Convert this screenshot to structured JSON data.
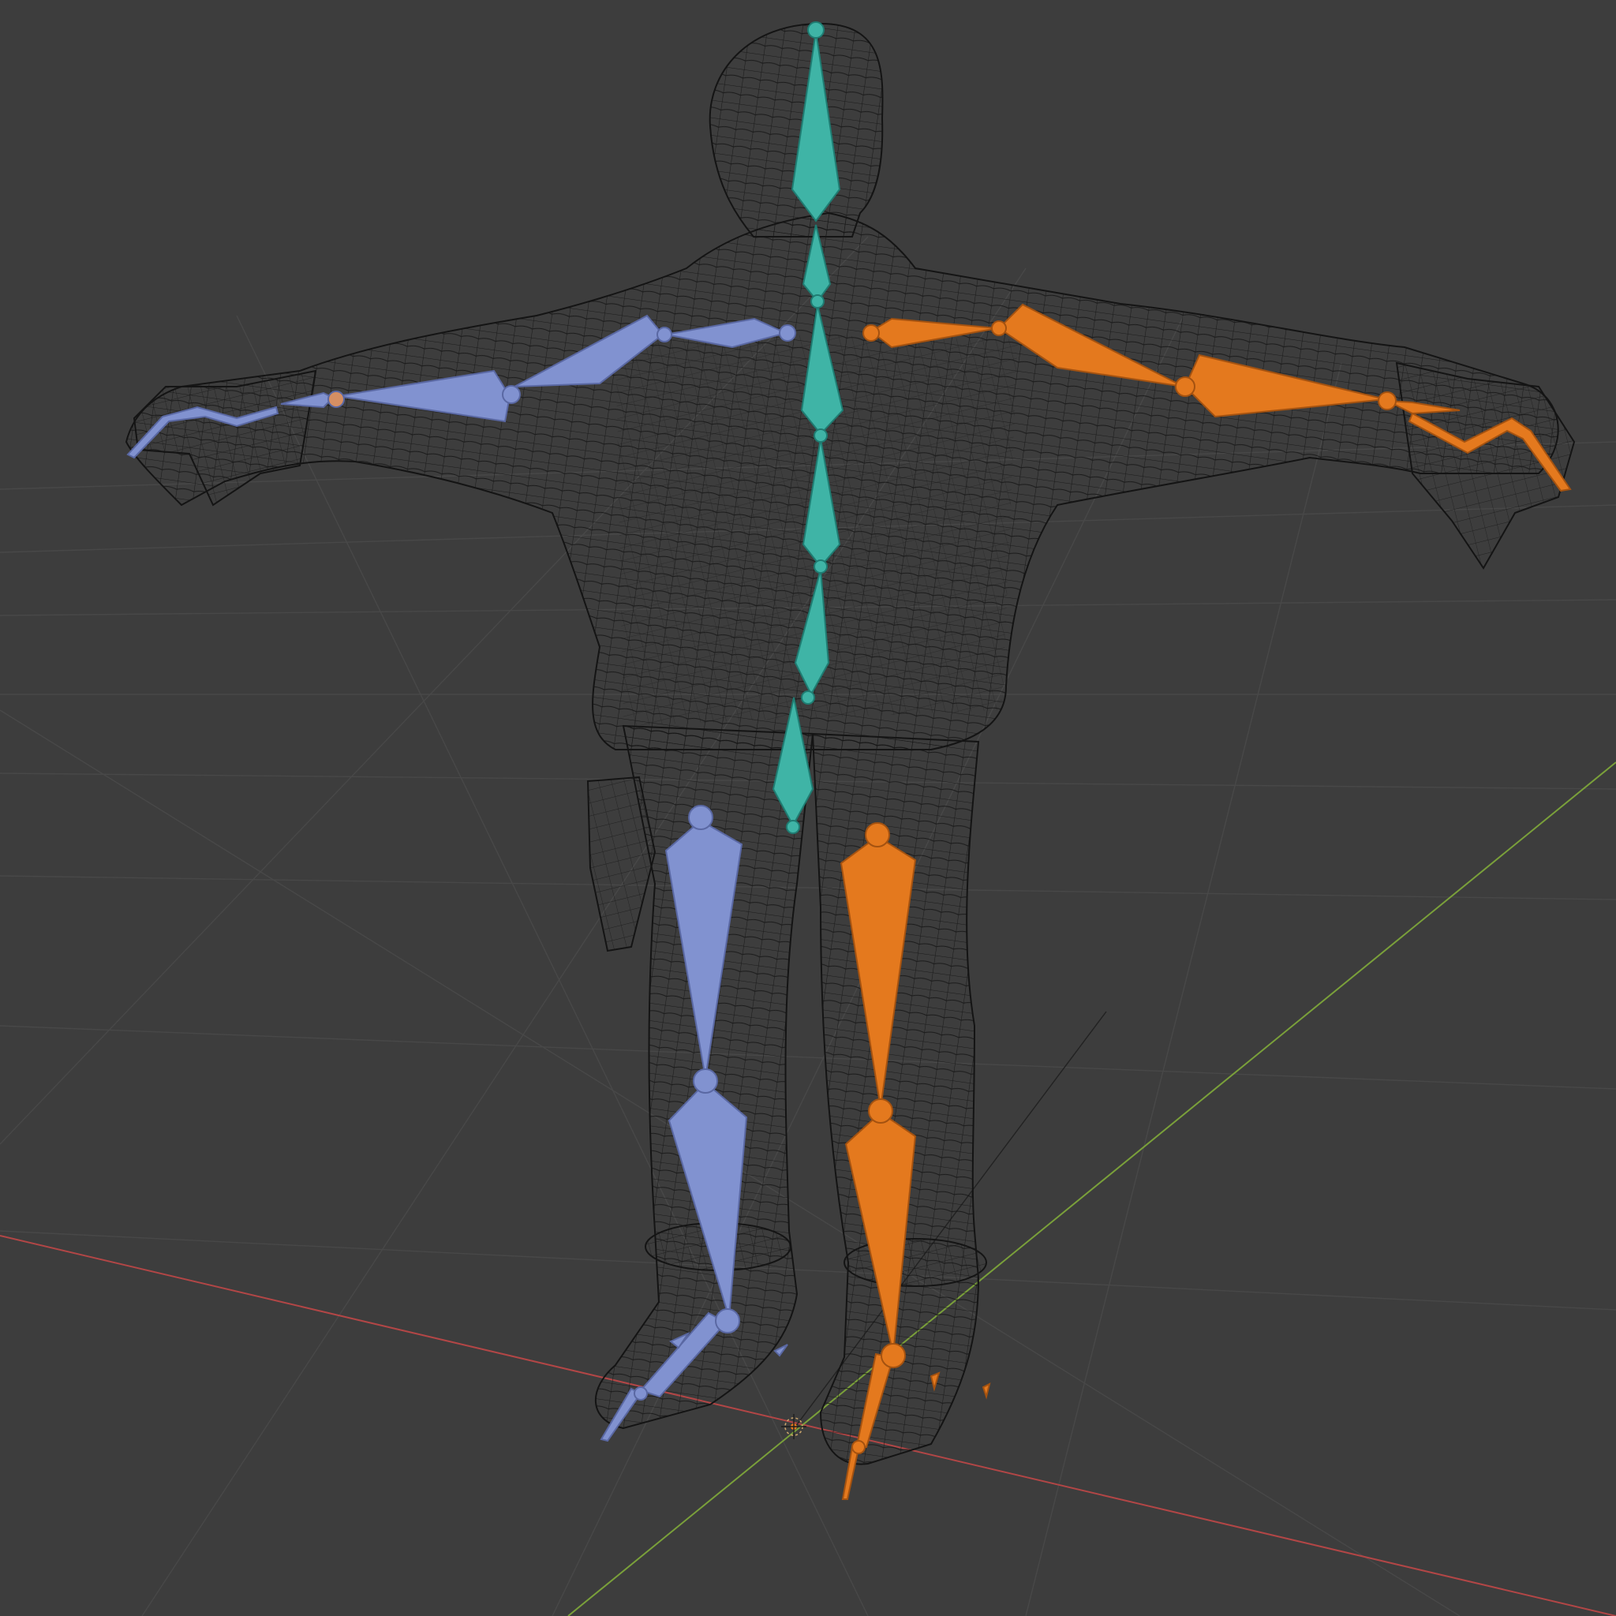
{
  "viewport": {
    "mode": "wireframe-armature",
    "background": "#3d3d3d"
  },
  "colors": {
    "grid": "#484848",
    "axis_x": "#b24646",
    "axis_y": "#7aa03a",
    "mesh": "#141414",
    "bone_center": "#3fb4a6",
    "bone_center_edge": "#1f7c72",
    "bone_left": "#8192d0",
    "bone_left_edge": "#5a68a3",
    "bone_right": "#e4791e",
    "bone_right_edge": "#a45210"
  },
  "icons": {
    "origin": "origin-3d-cursor-icon"
  },
  "armature": {
    "groups": [
      {
        "name": "spine",
        "color_key": "center"
      },
      {
        "name": "arm_left",
        "color_key": "left"
      },
      {
        "name": "arm_right",
        "color_key": "right"
      },
      {
        "name": "leg_left",
        "color_key": "left"
      },
      {
        "name": "leg_right",
        "color_key": "right"
      }
    ]
  }
}
